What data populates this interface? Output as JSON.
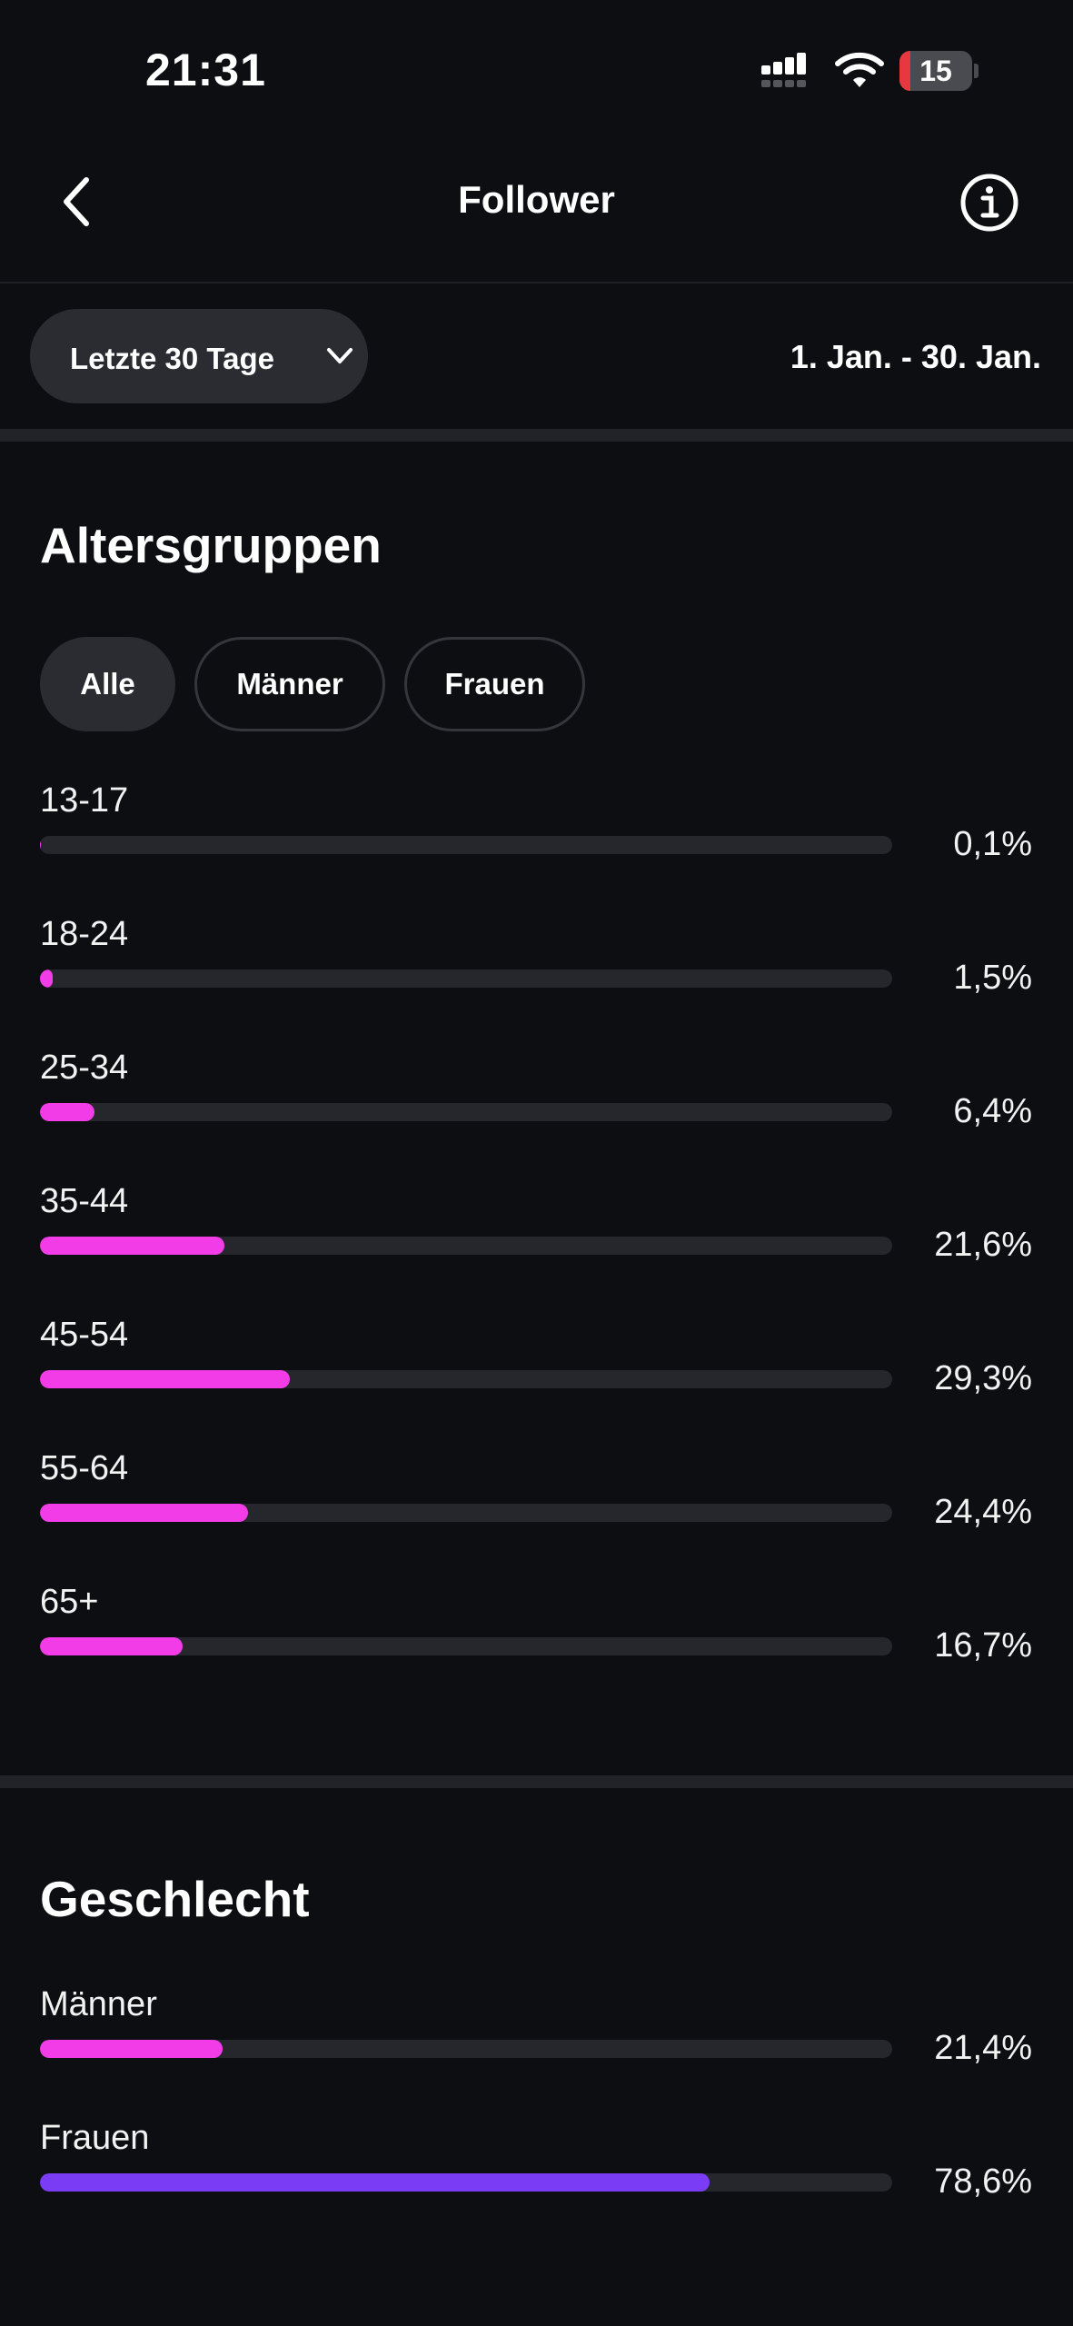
{
  "status_bar": {
    "time": "21:31",
    "battery_level": "15",
    "battery_fraction": 0.15,
    "battery_color": "#e8383f"
  },
  "nav": {
    "title": "Follower",
    "back_icon": "chevron-left-icon",
    "info_icon": "info-icon"
  },
  "filter": {
    "range_label": "Letzte 30 Tage",
    "date_range": "1. Jan. - 30. Jan."
  },
  "age_section": {
    "title": "Altersgruppen",
    "tabs": [
      {
        "label": "Alle",
        "active": true
      },
      {
        "label": "Männer",
        "active": false
      },
      {
        "label": "Frauen",
        "active": false
      }
    ],
    "bar_color": "#f23ce8",
    "rows": [
      {
        "label": "13-17",
        "value_text": "0,1%",
        "value": 0.1
      },
      {
        "label": "18-24",
        "value_text": "1,5%",
        "value": 1.5
      },
      {
        "label": "25-34",
        "value_text": "6,4%",
        "value": 6.4
      },
      {
        "label": "35-44",
        "value_text": "21,6%",
        "value": 21.6
      },
      {
        "label": "45-54",
        "value_text": "29,3%",
        "value": 29.3
      },
      {
        "label": "55-64",
        "value_text": "24,4%",
        "value": 24.4
      },
      {
        "label": "65+",
        "value_text": "16,7%",
        "value": 16.7
      }
    ]
  },
  "gender_section": {
    "title": "Geschlecht",
    "rows": [
      {
        "label": "Männer",
        "value_text": "21,4%",
        "value": 21.4,
        "color": "#f23ce8"
      },
      {
        "label": "Frauen",
        "value_text": "78,6%",
        "value": 78.6,
        "color": "#7a3cf5"
      }
    ]
  },
  "colors": {
    "background": "#0c0e12",
    "track": "#25272d",
    "chip": "#2a2c32"
  }
}
